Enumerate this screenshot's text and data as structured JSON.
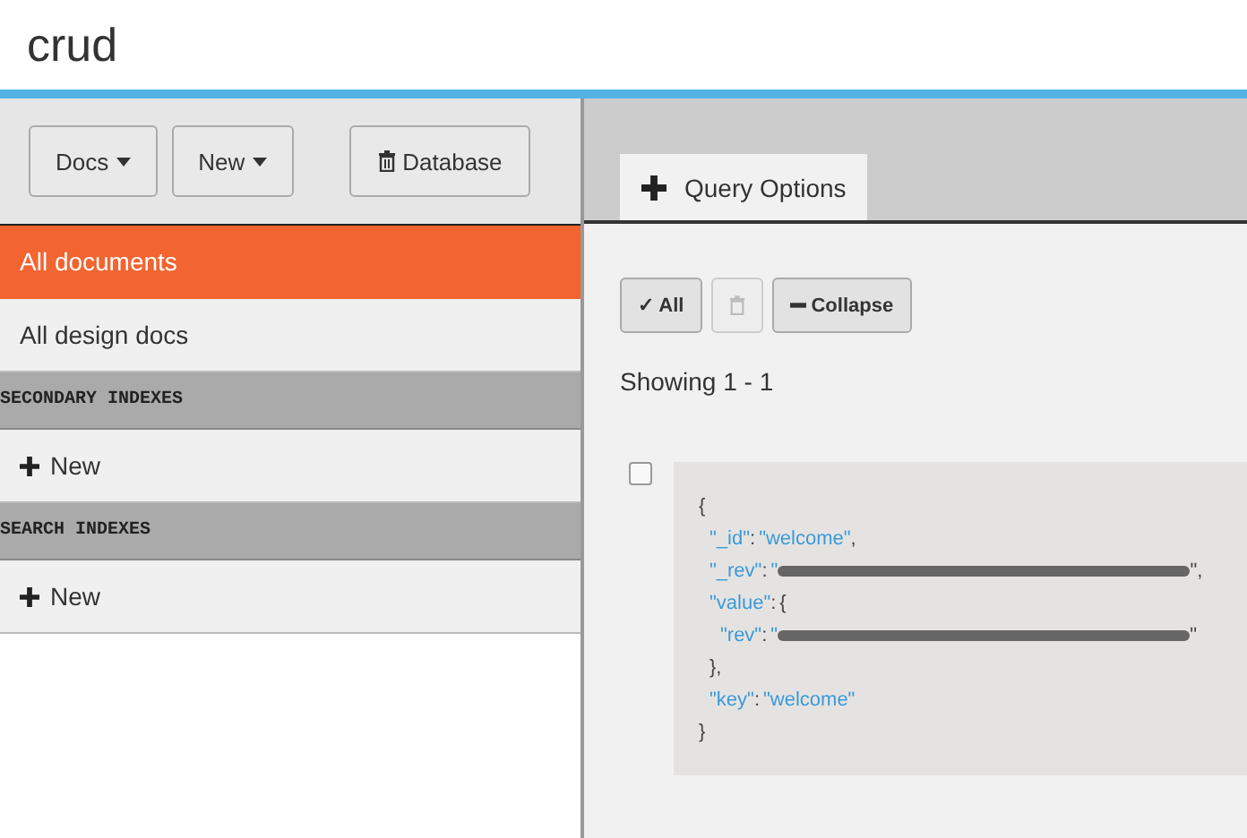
{
  "header": {
    "title": "crud"
  },
  "toolbar": {
    "buttons": [
      {
        "label": "Docs",
        "kind": "dropdown"
      },
      {
        "label": "New",
        "kind": "dropdown"
      },
      {
        "label": "Database",
        "kind": "trash"
      }
    ]
  },
  "sidebar": {
    "items": [
      {
        "kind": "link",
        "label": "All documents",
        "selected": true
      },
      {
        "kind": "link",
        "label": "All design docs",
        "selected": false
      },
      {
        "kind": "header",
        "label": "SECONDARY INDEXES"
      },
      {
        "kind": "new",
        "label": "New"
      },
      {
        "kind": "header",
        "label": "SEARCH INDEXES"
      },
      {
        "kind": "new",
        "label": "New"
      }
    ]
  },
  "tabs": [
    {
      "label": "Query Options",
      "selected": true
    }
  ],
  "actions": [
    {
      "kind": "text",
      "label": "✓ All",
      "disabled": false
    },
    {
      "kind": "trash",
      "disabled": true
    },
    {
      "kind": "minus",
      "label": "Collapse",
      "disabled": false
    }
  ],
  "showing": "Showing 1 - 1",
  "document": {
    "checked": false,
    "open": "{",
    "close": "}",
    "fields": [
      {
        "key": "\"_id\"",
        "colon": ":",
        "value": "\"welcome\"",
        "end": ","
      },
      {
        "key": "\"_rev\"",
        "colon": ":",
        "value": "\"",
        "redacted": true,
        "end": "\","
      },
      {
        "key": "\"value\"",
        "colon": ":",
        "open": "{",
        "children": [
          {
            "key": "\"rev\"",
            "colon": ":",
            "value": "\"",
            "redacted": true,
            "end": "\""
          }
        ],
        "close": "},"
      },
      {
        "key": "\"key\"",
        "colon": ":",
        "value": "\"welcome\""
      }
    ]
  }
}
